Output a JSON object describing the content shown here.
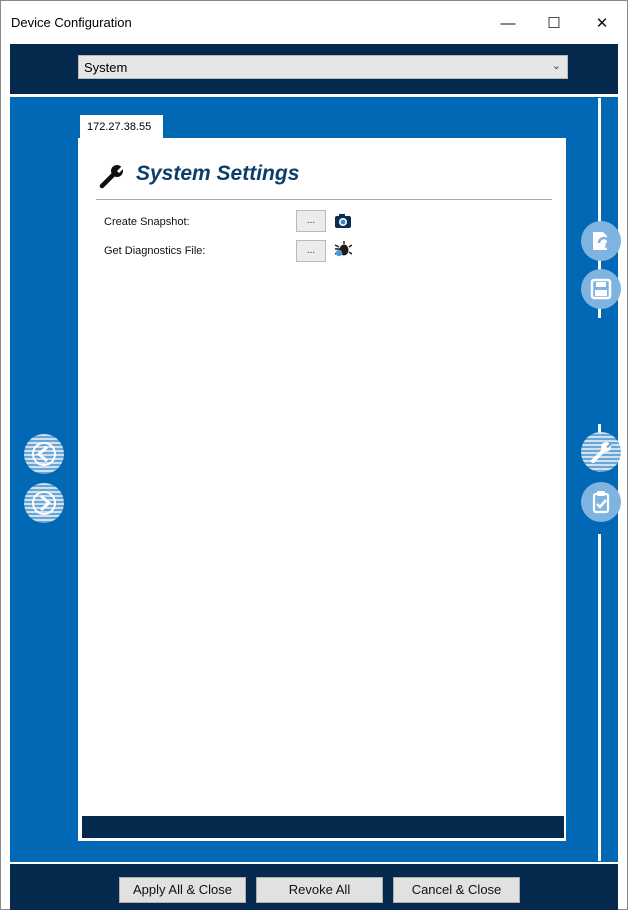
{
  "window": {
    "title": "Device Configuration",
    "controls": {
      "minimize": "—",
      "maximize": "☐",
      "close": "✕"
    }
  },
  "selector": {
    "value": "System"
  },
  "tab": {
    "label": "172.27.38.55"
  },
  "panel": {
    "title": "System Settings",
    "rows": [
      {
        "label": "Create Snapshot:",
        "button": "...",
        "icon": "camera-icon"
      },
      {
        "label": "Get Diagnostics File:",
        "button": "...",
        "icon": "bug-icon"
      }
    ]
  },
  "side_buttons": {
    "left": [
      "back-icon",
      "forward-icon"
    ],
    "right": [
      "open-file-icon",
      "save-icon",
      "wrench-icon",
      "clipboard-check-icon"
    ]
  },
  "footer": {
    "apply_all": "Apply All & Close",
    "revoke_all": "Revoke All",
    "cancel": "Cancel & Close"
  },
  "colors": {
    "main_blue": "#0068b4",
    "dark_navy": "#04294c",
    "heading": "#0d3d6b"
  }
}
